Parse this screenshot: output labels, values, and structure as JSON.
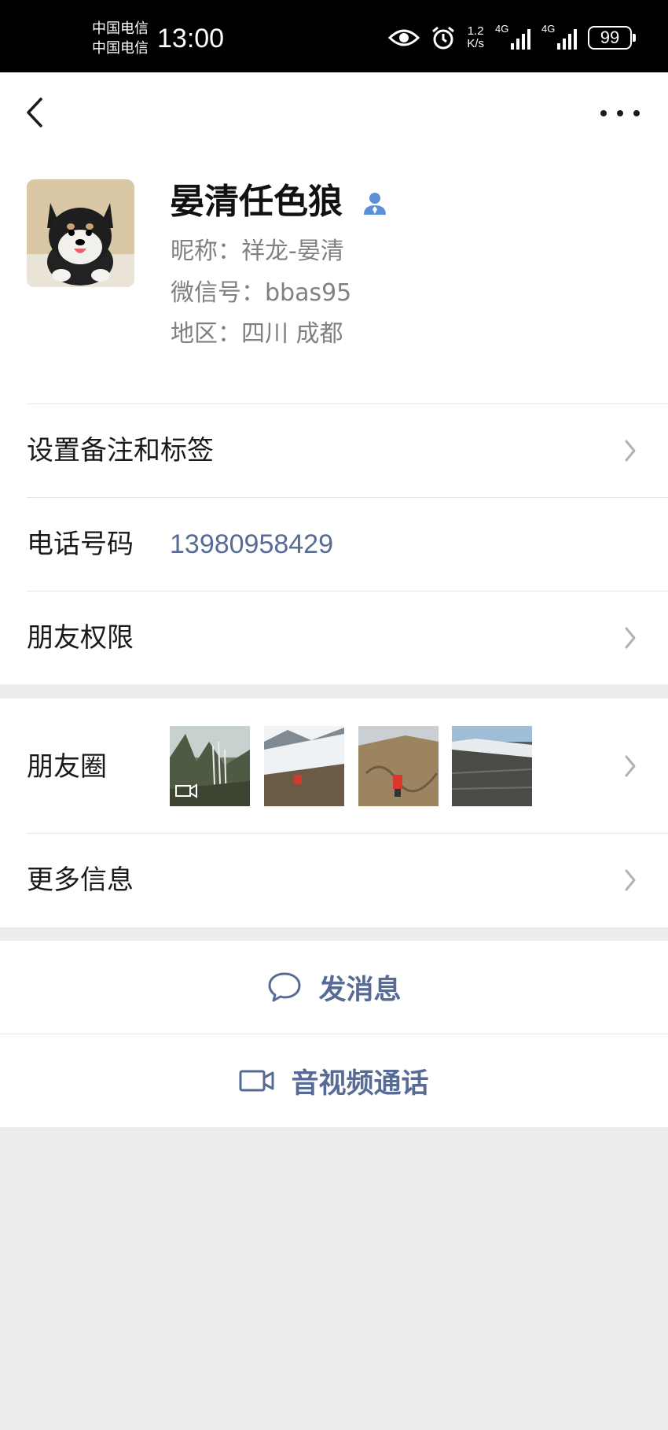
{
  "status_bar": {
    "carrier_1": "中国电信",
    "carrier_2": "中国电信",
    "time": "13:00",
    "speed_value": "1.2",
    "speed_unit": "K/s",
    "signal_1_tag": "4G",
    "signal_2_tag": "4G",
    "battery": "99"
  },
  "profile": {
    "name": "晏清任色狼",
    "nickname": "昵称：祥龙-晏清",
    "wechat_id": "微信号：bbas95",
    "region": "地区：四川  成都"
  },
  "rows": {
    "remark_label": "设置备注和标签",
    "phone_label": "电话号码",
    "phone_value": "13980958429",
    "permissions_label": "朋友权限",
    "moments_label": "朋友圈",
    "more_info_label": "更多信息"
  },
  "actions": {
    "message_label": "发消息",
    "call_label": "音视频通话"
  },
  "colors": {
    "link_blue": "#576b95",
    "background": "#ededed"
  }
}
